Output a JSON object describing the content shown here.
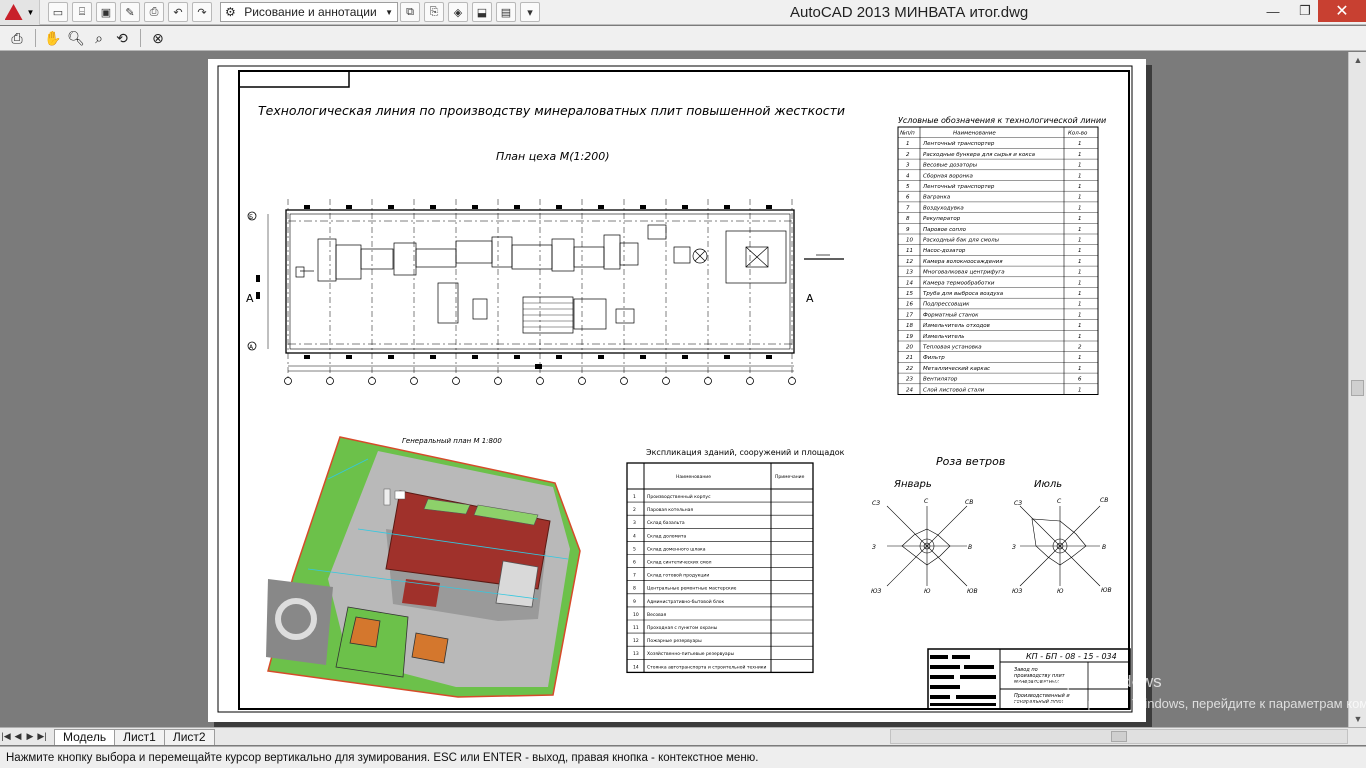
{
  "window": {
    "title": "AutoCAD 2013    МИНВАТА итог.dwg",
    "workspace": "Рисование и аннотации",
    "controls": {
      "minimize": "—",
      "maximize": "❐",
      "close": "✕"
    }
  },
  "toolbar": {
    "icons": [
      "print-icon",
      "pan-icon",
      "zoom-icon",
      "zoom-window-icon",
      "zoom-previous-icon",
      "close-preview-icon"
    ]
  },
  "drawing": {
    "main_title": "Технологическая линия по производству минераловатных плит повышенной жесткости",
    "plan_title": "План цеха М(1:200)",
    "section_mark_left": "A",
    "section_mark_right": "A",
    "grid_rows": [
      "Б",
      "А"
    ],
    "legend_title": "Условные обозначения к технологической линии",
    "legend_headers": [
      "№п/п",
      "Наименование",
      "Кол-во"
    ],
    "legend_rows": [
      [
        "1",
        "Ленточный транспортер",
        "1"
      ],
      [
        "2",
        "Расходные бункера для сырья и кокса",
        "1"
      ],
      [
        "3",
        "Весовые дозаторы",
        "1"
      ],
      [
        "4",
        "Сборная воронка",
        "1"
      ],
      [
        "5",
        "Ленточный транспортер",
        "1"
      ],
      [
        "6",
        "Вагранка",
        "1"
      ],
      [
        "7",
        "Воздуходувка",
        "1"
      ],
      [
        "8",
        "Рекуператор",
        "1"
      ],
      [
        "9",
        "Паровое сопло",
        "1"
      ],
      [
        "10",
        "Расходный бак для смолы",
        "1"
      ],
      [
        "11",
        "Насос-дозатор",
        "1"
      ],
      [
        "12",
        "Камера волокноосаждения",
        "1"
      ],
      [
        "13",
        "Многовалковая центрифуга",
        "1"
      ],
      [
        "14",
        "Камера термообработки",
        "1"
      ],
      [
        "15",
        "Труба для выброса воздуха",
        "1"
      ],
      [
        "16",
        "Подпрессовщик",
        "1"
      ],
      [
        "17",
        "Форматный станок",
        "1"
      ],
      [
        "18",
        "Измельчитель отходов",
        "1"
      ],
      [
        "19",
        "Измельчитель",
        "1"
      ],
      [
        "20",
        "Тепловая установка",
        "2"
      ],
      [
        "21",
        "Фильтр",
        "1"
      ],
      [
        "22",
        "Металлический каркас",
        "1"
      ],
      [
        "23",
        "Вентилятор",
        "6"
      ],
      [
        "24",
        "Слой листовой стали",
        "1"
      ]
    ],
    "genplan_title": "Генеральный план  М 1:800",
    "explication_title": "Экспликация зданий, сооружений и площадок",
    "explication_headers": [
      "",
      "Наименование",
      "Примечание"
    ],
    "explication_rows": [
      [
        "1",
        "Производственный корпус"
      ],
      [
        "2",
        "Паровая котельная"
      ],
      [
        "3",
        "Склад базальта"
      ],
      [
        "4",
        "Склад доломита"
      ],
      [
        "5",
        "Склад доменного шлака"
      ],
      [
        "6",
        "Склад синтетических смол"
      ],
      [
        "7",
        "Склад готовой продукции"
      ],
      [
        "8",
        "Центральные ремонтные мастерские"
      ],
      [
        "9",
        "Административно-бытовой блок"
      ],
      [
        "10",
        "Весовая"
      ],
      [
        "11",
        "Проходная с пунктом охраны"
      ],
      [
        "12",
        "Пожарные резервуары"
      ],
      [
        "13",
        "Хозяйственно-питьевые резервуары"
      ],
      [
        "14",
        "Стоянка автотранспорта и строительной техники"
      ]
    ],
    "windrose_title": "Роза ветров",
    "windrose_jan": "Январь",
    "windrose_jul": "Июль",
    "directions": [
      "С",
      "СВ",
      "В",
      "ЮВ",
      "Ю",
      "ЮЗ",
      "З",
      "СЗ"
    ],
    "stamp_code": "КП - БП - 08 - 15 - 034",
    "stamp_line1": "Завод по",
    "stamp_line2": "производству плит",
    "stamp_line3": "минераловатных",
    "stamp_line4": "Производственный и",
    "stamp_line5": "генеральный план"
  },
  "tabs": [
    "Модель",
    "Лист1",
    "Лист2"
  ],
  "command_line": "Нажмите кнопку выбора и перемещайте курсор вертикально для зумирования. ESC или ENTER - выход, правая кнопка - контекстное меню.",
  "watermark": {
    "line1": "Активация Windows",
    "line2": "Чтобы активировать Windows, перейдите к параметрам компьютера."
  }
}
